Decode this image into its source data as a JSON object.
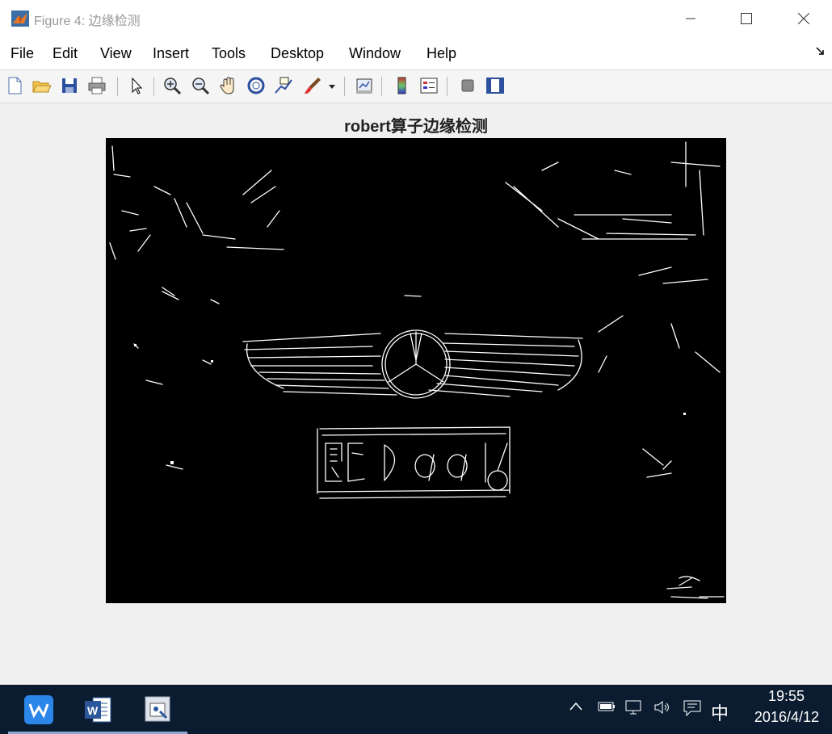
{
  "window": {
    "title": "Figure 4: 边缘检测",
    "controls": [
      "minimize",
      "maximize",
      "close"
    ]
  },
  "menu": [
    "File",
    "Edit",
    "View",
    "Insert",
    "Tools",
    "Desktop",
    "Window",
    "Help"
  ],
  "toolbar_icons": [
    "new-figure-icon",
    "open-file-icon",
    "save-icon",
    "print-icon",
    "edit-plot-arrow-icon",
    "zoom-in-icon",
    "zoom-out-icon",
    "pan-hand-icon",
    "rotate-3d-icon",
    "data-cursor-icon",
    "brush-icon",
    "link-plot-icon",
    "insert-colorbar-icon",
    "insert-legend-icon",
    "hide-plot-tools-icon",
    "show-plot-tools-icon"
  ],
  "axes": {
    "title": "robert算子边缘检测",
    "image_content": "edge-detection result: license plate \"闽C D9016\" and car logo"
  },
  "taskbar": {
    "apps": [
      "wps-icon",
      "word-icon",
      "matlab-figure-icon"
    ],
    "ime": "中",
    "time": "19:55",
    "date": "2016/4/12"
  },
  "colors": {
    "plot_background": "#000000",
    "edge_lines": "#ffffff",
    "taskbar": "#0b1c30",
    "window_bg": "#f0f0f0"
  }
}
